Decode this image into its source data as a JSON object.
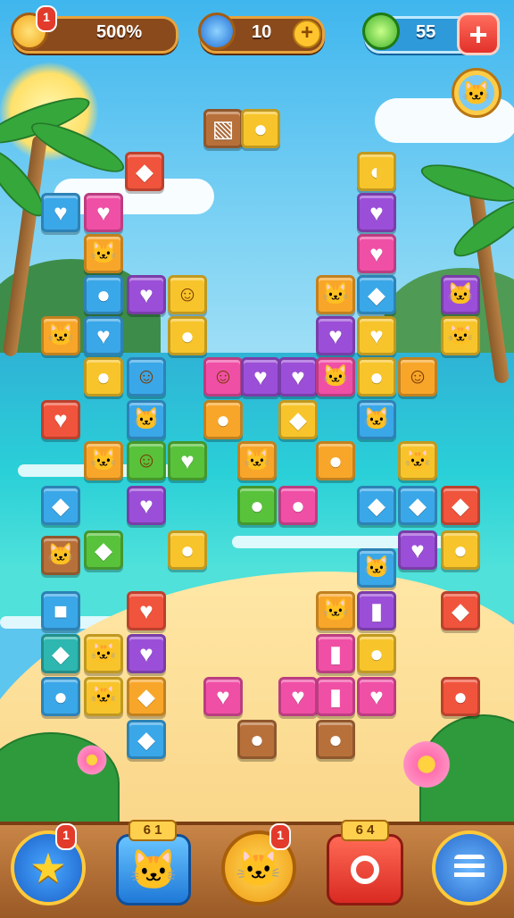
{
  "hud": {
    "score": "500%",
    "gems": "10",
    "lives": "55",
    "score_badge": "1",
    "plus_add": "+",
    "lives_add": "+"
  },
  "bottom_bar": {
    "star_badge": "1",
    "pet_tag": "6 1",
    "boost_badge": "1",
    "shop_tag": "6 4"
  },
  "colors": {
    "red": "#f0543c",
    "orange": "#f8a62a",
    "yellow": "#f7c52b",
    "green": "#58c23b",
    "blue": "#3aa7e8",
    "purple": "#9b4fd8",
    "pink": "#f04fa6",
    "brown": "#b8703a",
    "teal": "#2db7b0"
  },
  "tiles": [
    {
      "c": "brown",
      "g": "▧"
    },
    {
      "c": "yellow",
      "g": "●"
    },
    {
      "c": "red",
      "g": "◆"
    },
    {
      "c": "yellow",
      "g": "◐"
    },
    {
      "c": "blue",
      "g": "♥"
    },
    {
      "c": "pink",
      "g": "♥"
    },
    {
      "c": "purple",
      "g": "♥"
    },
    {
      "c": "orange",
      "g": "🐱"
    },
    {
      "c": "pink",
      "g": "♥"
    },
    {
      "c": "blue",
      "g": "●"
    },
    {
      "c": "purple",
      "g": "♥"
    },
    {
      "c": "yellow",
      "g": "☺"
    },
    {
      "c": "orange",
      "g": "🐱"
    },
    {
      "c": "blue",
      "g": "◆"
    },
    {
      "c": "purple",
      "g": "🐱"
    },
    {
      "c": "orange",
      "g": "🐱"
    },
    {
      "c": "blue",
      "g": "♥"
    },
    {
      "c": "yellow",
      "g": "●"
    },
    {
      "c": "purple",
      "g": "♥"
    },
    {
      "c": "yellow",
      "g": "♥"
    },
    {
      "c": "yellow",
      "g": "🐱"
    },
    {
      "c": "yellow",
      "g": "●"
    },
    {
      "c": "blue",
      "g": "☺"
    },
    {
      "c": "pink",
      "g": "☺"
    },
    {
      "c": "purple",
      "g": "♥"
    },
    {
      "c": "purple",
      "g": "♥"
    },
    {
      "c": "pink",
      "g": "🐱"
    },
    {
      "c": "yellow",
      "g": "●"
    },
    {
      "c": "orange",
      "g": "☺"
    },
    {
      "c": "red",
      "g": "♥"
    },
    {
      "c": "blue",
      "g": "🐱"
    },
    {
      "c": "orange",
      "g": "●"
    },
    {
      "c": "yellow",
      "g": "◆"
    },
    {
      "c": "blue",
      "g": "🐱"
    },
    {
      "c": "orange",
      "g": "🐱"
    },
    {
      "c": "green",
      "g": "☺"
    },
    {
      "c": "green",
      "g": "♥"
    },
    {
      "c": "orange",
      "g": "🐱"
    },
    {
      "c": "orange",
      "g": "●"
    },
    {
      "c": "yellow",
      "g": "🐱"
    },
    {
      "c": "blue",
      "g": "◆"
    },
    {
      "c": "purple",
      "g": "♥"
    },
    {
      "c": "green",
      "g": "●"
    },
    {
      "c": "pink",
      "g": "●"
    },
    {
      "c": "blue",
      "g": "◆"
    },
    {
      "c": "blue",
      "g": "◆"
    },
    {
      "c": "red",
      "g": "◆"
    },
    {
      "c": "brown",
      "g": "🐱"
    },
    {
      "c": "green",
      "g": "◆"
    },
    {
      "c": "yellow",
      "g": "●"
    },
    {
      "c": "purple",
      "g": "♥"
    },
    {
      "c": "yellow",
      "g": "●"
    },
    {
      "c": "blue",
      "g": "■"
    },
    {
      "c": "red",
      "g": "♥"
    },
    {
      "c": "blue",
      "g": "🐱"
    },
    {
      "c": "orange",
      "g": "🐱"
    },
    {
      "c": "purple",
      "g": "▮"
    },
    {
      "c": "red",
      "g": "◆"
    },
    {
      "c": "teal",
      "g": "◆"
    },
    {
      "c": "yellow",
      "g": "🐱"
    },
    {
      "c": "purple",
      "g": "♥"
    },
    {
      "c": "pink",
      "g": "▮"
    },
    {
      "c": "yellow",
      "g": "●"
    },
    {
      "c": "blue",
      "g": "●"
    },
    {
      "c": "yellow",
      "g": "🐱"
    },
    {
      "c": "orange",
      "g": "◆"
    },
    {
      "c": "pink",
      "g": "♥"
    },
    {
      "c": "pink",
      "g": "♥"
    },
    {
      "c": "pink",
      "g": "▮"
    },
    {
      "c": "pink",
      "g": "♥"
    },
    {
      "c": "red",
      "g": "●"
    },
    {
      "c": "blue",
      "g": "◆"
    },
    {
      "c": "brown",
      "g": "●"
    },
    {
      "c": "brown",
      "g": "●"
    }
  ]
}
